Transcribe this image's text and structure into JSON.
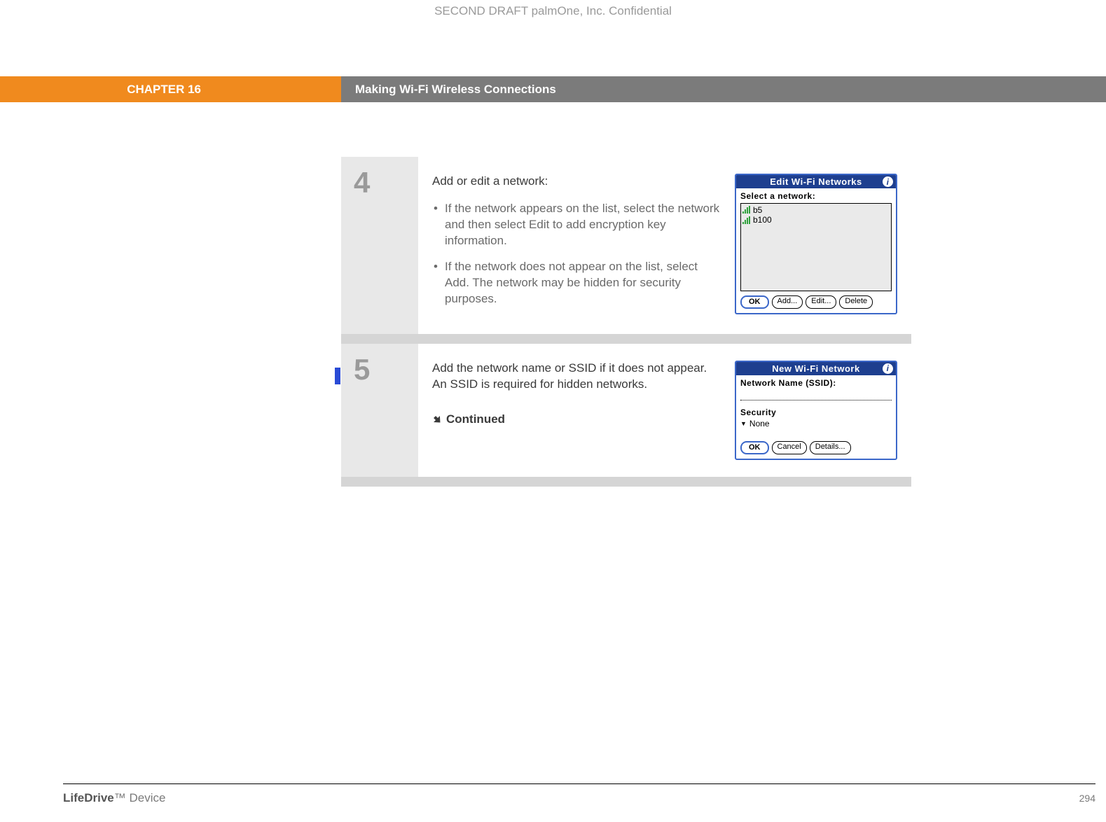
{
  "confidential_header": "SECOND DRAFT palmOne, Inc.  Confidential",
  "chapter_label": "CHAPTER 16",
  "chapter_title": "Making Wi-Fi Wireless Connections",
  "step4": {
    "number": "4",
    "intro": "Add or edit a network:",
    "bullet1": "If the network appears on the list, select the network and then select Edit to add encryption key information.",
    "bullet2": "If the network does not appear on the list, select Add. The network may be hidden for security purposes.",
    "screenshot": {
      "title": "Edit Wi-Fi Networks",
      "label": "Select a network:",
      "items": [
        "b5",
        "b100"
      ],
      "buttons": {
        "ok": "OK",
        "add": "Add...",
        "edit": "Edit...",
        "delete": "Delete"
      }
    }
  },
  "step5": {
    "number": "5",
    "text": "Add the network name or SSID if it does not appear. An SSID is required for hidden networks.",
    "continued": "Continued",
    "screenshot": {
      "title": "New Wi-Fi Network",
      "ssid_label": "Network Name (SSID):",
      "security_label": "Security",
      "security_value": "None",
      "buttons": {
        "ok": "OK",
        "cancel": "Cancel",
        "details": "Details..."
      }
    }
  },
  "footer": {
    "device_bold": "LifeDrive",
    "device_tm": "™",
    "device_rest": "Device",
    "page": "294"
  }
}
